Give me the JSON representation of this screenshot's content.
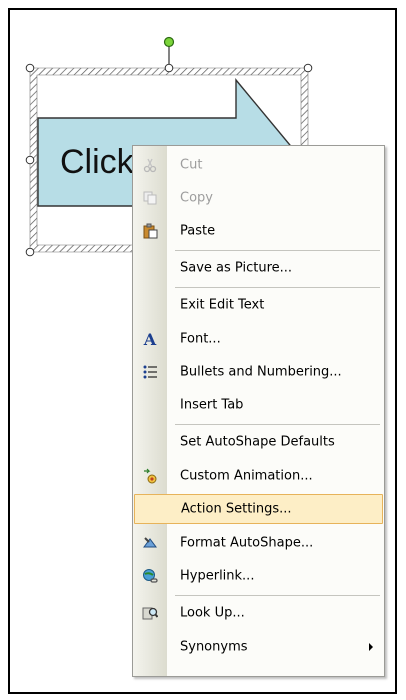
{
  "slide": {
    "shape_text": "Click"
  },
  "menu": {
    "items": [
      {
        "label": "Cut",
        "icon": "scissors-icon",
        "enabled": false
      },
      {
        "label": "Copy",
        "icon": "copy-icon",
        "enabled": false
      },
      {
        "label": "Paste",
        "icon": "paste-icon",
        "enabled": true
      },
      {
        "label": "Save as Picture...",
        "icon": "",
        "enabled": true
      },
      {
        "label": "Exit Edit Text",
        "icon": "",
        "enabled": true
      },
      {
        "label": "Font...",
        "icon": "font-icon",
        "enabled": true
      },
      {
        "label": "Bullets and Numbering...",
        "icon": "bullets-icon",
        "enabled": true
      },
      {
        "label": "Insert Tab",
        "icon": "",
        "enabled": true
      },
      {
        "label": "Set AutoShape Defaults",
        "icon": "",
        "enabled": true
      },
      {
        "label": "Custom Animation...",
        "icon": "custom-animation-icon",
        "enabled": true
      },
      {
        "label": "Action Settings...",
        "icon": "",
        "enabled": true,
        "highlighted": true
      },
      {
        "label": "Format AutoShape...",
        "icon": "format-autoshape-icon",
        "enabled": true
      },
      {
        "label": "Hyperlink...",
        "icon": "hyperlink-icon",
        "enabled": true
      },
      {
        "label": "Look Up...",
        "icon": "research-icon",
        "enabled": true
      },
      {
        "label": "Synonyms",
        "icon": "",
        "enabled": true,
        "submenu": true
      }
    ]
  },
  "colors": {
    "shape_fill": "#b7dde6",
    "highlight": "#fdeec6",
    "highlight_border": "#e7b35a"
  }
}
